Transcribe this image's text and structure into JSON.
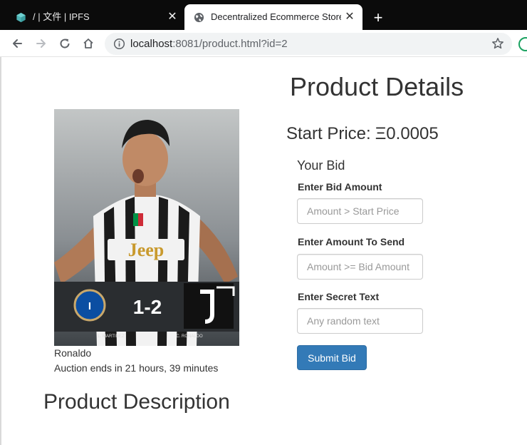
{
  "browser": {
    "tabs": [
      {
        "title": "/ | 文件 | IPFS",
        "favicon": "ipfs-cube-icon",
        "active": false
      },
      {
        "title": "Decentralized Ecommerce Store",
        "favicon": "globe-icon",
        "active": true
      }
    ],
    "close_glyph": "✕",
    "new_tab_glyph": "+",
    "url_host": "localhost",
    "url_path": ":8081/product.html?id=2",
    "icons": {
      "back": "back-arrow-icon",
      "forward": "forward-arrow-icon",
      "reload": "reload-icon",
      "home": "home-icon",
      "info": "info-icon",
      "bookmark": "star-icon",
      "extension": "extension-icon"
    }
  },
  "product": {
    "name": "Ronaldo",
    "auction_ends": "Auction ends in 21 hours, 39 minutes",
    "image_caption": {
      "sponsor": "Jeep",
      "score": "1-2",
      "scorer_left": "L. MARTINEZ",
      "scorer_right": "C. RONALDO"
    },
    "description_heading": "Product Description"
  },
  "details": {
    "heading": "Product Details",
    "start_price_label": "Start Price:",
    "start_price_value": "Ξ0.0005"
  },
  "bid_form": {
    "heading": "Your Bid",
    "fields": [
      {
        "label": "Enter Bid Amount",
        "placeholder": "Amount > Start Price",
        "value": ""
      },
      {
        "label": "Enter Amount To Send",
        "placeholder": "Amount >= Bid Amount",
        "value": ""
      },
      {
        "label": "Enter Secret Text",
        "placeholder": "Any random text",
        "value": ""
      }
    ],
    "submit_label": "Submit Bid"
  },
  "colors": {
    "tabbar": "#0b0b0b",
    "primary_button": "#337ab7",
    "text": "#333333"
  }
}
